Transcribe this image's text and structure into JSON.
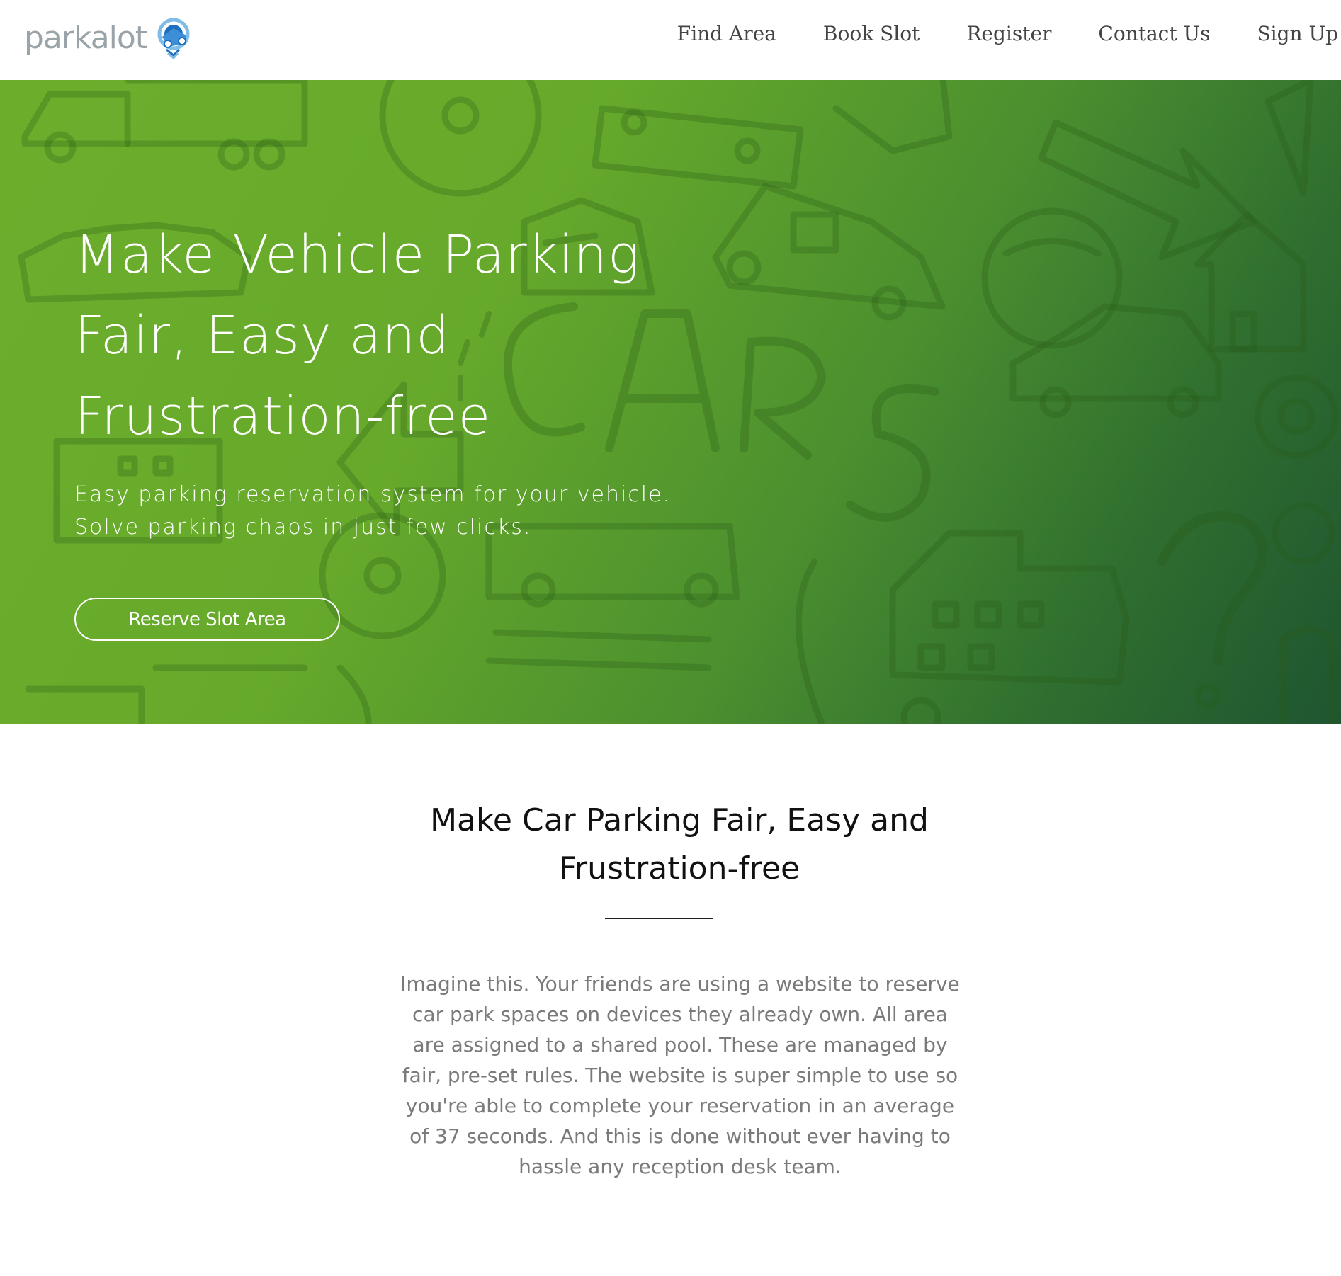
{
  "brand": {
    "name": "parkalot",
    "logo_icon": "car-keys-icon",
    "logo_colors": [
      "#1f6fc0",
      "#3c8fd6",
      "#7fbde8"
    ]
  },
  "nav": {
    "items": [
      {
        "label": "Find Area"
      },
      {
        "label": "Book Slot"
      },
      {
        "label": "Register"
      },
      {
        "label": "Contact Us"
      },
      {
        "label": "Sign Up"
      }
    ]
  },
  "hero": {
    "title_lines": [
      "Make Vehicle Parking",
      "Fair, Easy and",
      "Frustration-free"
    ],
    "subtitle": "Easy parking reservation system for your vehicle. Solve parking chaos in just few clicks.",
    "button_label": "Reserve Slot Area",
    "gradient": [
      "#6cae2c",
      "#1f5530"
    ]
  },
  "about": {
    "title": "Make Car Parking Fair, Easy and Frustration-free",
    "body": "Imagine this. Your friends are using a website to reserve car park spaces on devices they already own. All area are assigned to a shared pool. These are managed by fair, pre-set rules. The website is super simple to use so you're able to complete your reservation in an average of 37 seconds. And this is done without ever having to hassle any reception desk team."
  }
}
